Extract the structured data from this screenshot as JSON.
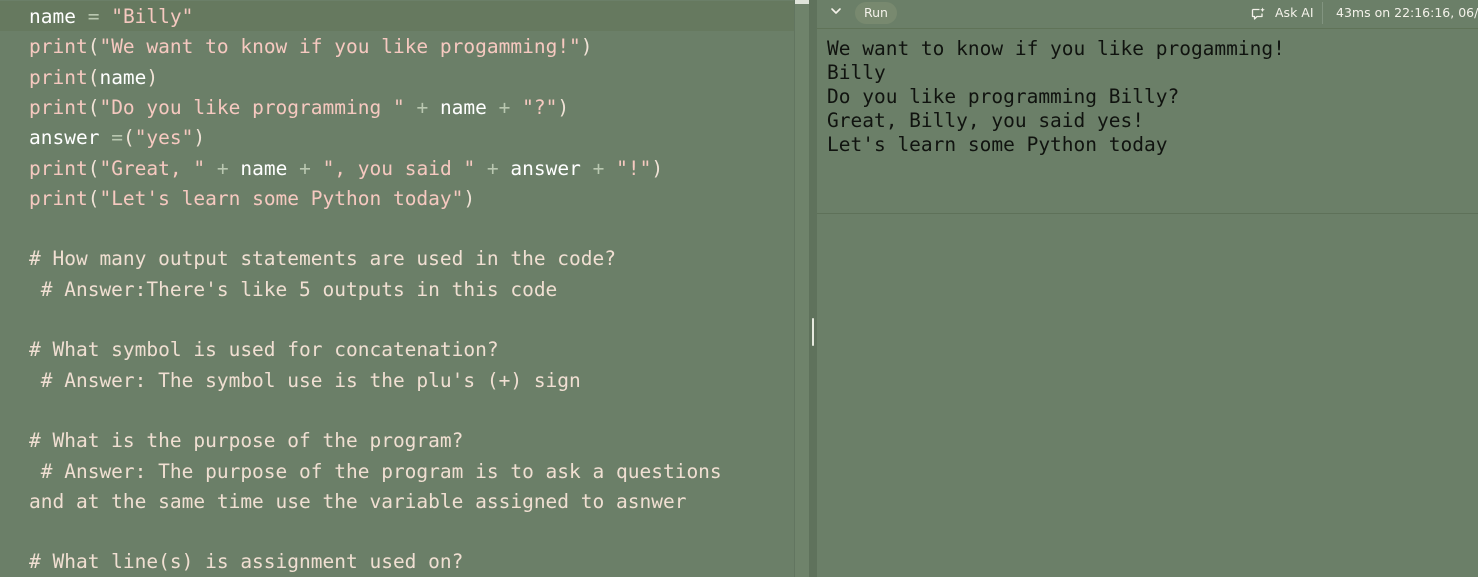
{
  "editor": {
    "lines": [
      {
        "tokens": [
          {
            "t": "name",
            "c": "ident"
          },
          {
            "t": " = ",
            "c": "op"
          },
          {
            "t": "\"Billy\"",
            "c": "str"
          }
        ]
      },
      {
        "tokens": [
          {
            "t": "print",
            "c": "func"
          },
          {
            "t": "(",
            "c": "punct"
          },
          {
            "t": "\"We want to know if you like progamming!\"",
            "c": "str"
          },
          {
            "t": ")",
            "c": "punct"
          }
        ]
      },
      {
        "tokens": [
          {
            "t": "print",
            "c": "func"
          },
          {
            "t": "(",
            "c": "punct"
          },
          {
            "t": "name",
            "c": "ident"
          },
          {
            "t": ")",
            "c": "punct"
          }
        ]
      },
      {
        "tokens": [
          {
            "t": "print",
            "c": "func"
          },
          {
            "t": "(",
            "c": "punct"
          },
          {
            "t": "\"Do you like programming \"",
            "c": "str"
          },
          {
            "t": " + ",
            "c": "op"
          },
          {
            "t": "name",
            "c": "ident"
          },
          {
            "t": " + ",
            "c": "op"
          },
          {
            "t": "\"?\"",
            "c": "str"
          },
          {
            "t": ")",
            "c": "punct"
          }
        ]
      },
      {
        "tokens": [
          {
            "t": "answer",
            "c": "ident"
          },
          {
            "t": " =",
            "c": "op"
          },
          {
            "t": "(",
            "c": "punct"
          },
          {
            "t": "\"yes\"",
            "c": "str"
          },
          {
            "t": ")",
            "c": "punct"
          }
        ]
      },
      {
        "tokens": [
          {
            "t": "print",
            "c": "func"
          },
          {
            "t": "(",
            "c": "punct"
          },
          {
            "t": "\"Great, \"",
            "c": "str"
          },
          {
            "t": " + ",
            "c": "op"
          },
          {
            "t": "name",
            "c": "ident"
          },
          {
            "t": " + ",
            "c": "op"
          },
          {
            "t": "\", you said \"",
            "c": "str"
          },
          {
            "t": " + ",
            "c": "op"
          },
          {
            "t": "answer",
            "c": "ident"
          },
          {
            "t": " + ",
            "c": "op"
          },
          {
            "t": "\"!\"",
            "c": "str"
          },
          {
            "t": ")",
            "c": "punct"
          }
        ]
      },
      {
        "tokens": [
          {
            "t": "print",
            "c": "func"
          },
          {
            "t": "(",
            "c": "punct"
          },
          {
            "t": "\"Let's learn some Python today\"",
            "c": "str"
          },
          {
            "t": ")",
            "c": "punct"
          }
        ]
      },
      {
        "tokens": []
      },
      {
        "tokens": [
          {
            "t": "# How many output statements are used in the code?",
            "c": "comment"
          }
        ]
      },
      {
        "tokens": [
          {
            "t": " # Answer:There's like 5 outputs in this code",
            "c": "comment"
          }
        ]
      },
      {
        "tokens": []
      },
      {
        "tokens": [
          {
            "t": "# What symbol is used for concatenation?",
            "c": "comment"
          }
        ]
      },
      {
        "tokens": [
          {
            "t": " # Answer: The symbol use is the plu's (+) sign",
            "c": "comment"
          }
        ]
      },
      {
        "tokens": []
      },
      {
        "tokens": [
          {
            "t": "# What is the purpose of the program?",
            "c": "comment"
          }
        ]
      },
      {
        "tokens": [
          {
            "t": " # Answer: The purpose of the program is to ask a questions",
            "c": "comment"
          }
        ]
      },
      {
        "tokens": [
          {
            "t": "and at the same time use the variable assigned to asnwer",
            "c": "comment"
          }
        ]
      },
      {
        "tokens": []
      },
      {
        "tokens": [
          {
            "t": "# What line(s) is assignment used on?",
            "c": "comment"
          }
        ]
      }
    ]
  },
  "console": {
    "run_label": "Run",
    "ask_ai_label": "Ask AI",
    "timing": "43ms on 22:16:16, 06/",
    "icons": {
      "collapse": "chevron-down-icon",
      "ask_ai": "chat-sparkle-icon"
    },
    "output": [
      "We want to know if you like progamming!",
      "Billy",
      "Do you like programming Billy?",
      "Great, Billy, you said yes!",
      "Let's learn some Python today"
    ]
  },
  "colors": {
    "background": "#6b7f68",
    "string": "#f6c9c0",
    "identifier": "#ffffff",
    "comment": "#f0dfd2",
    "console_text": "#10130f"
  }
}
